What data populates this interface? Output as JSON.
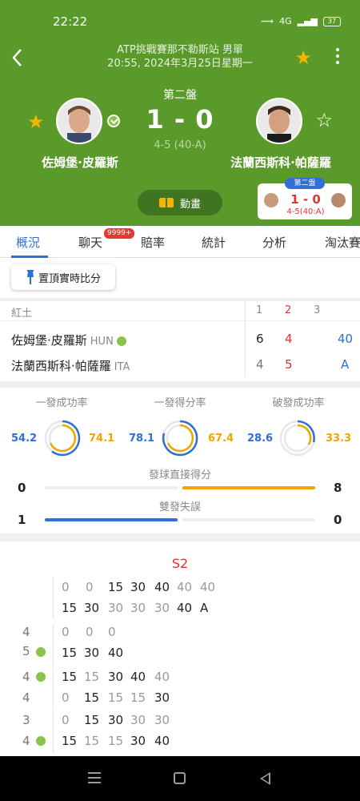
{
  "status_bar": {
    "time": "22:22",
    "icons": [
      "signal-icon",
      "network-icon",
      "wifi-icon"
    ],
    "network_label": "4G",
    "battery": "37"
  },
  "header": {
    "tournament": "ATP挑戰賽那不勒斯站 男單",
    "datetime": "20:55, 2024年3月25日星期一",
    "set_label": "第二盤",
    "score": "1 - 0",
    "subscore": "4-5 (40-A)",
    "favorite_star_color": "#f4b400",
    "header_color": "#5a9a2a"
  },
  "players": {
    "left": {
      "name": "佐姆堡·皮羅斯",
      "favorited": true,
      "serving": true
    },
    "right": {
      "name": "法蘭西斯科·帕薩羅",
      "favorited": false,
      "serving": false
    }
  },
  "animation_button": {
    "label": "動畫"
  },
  "mini_score": {
    "tag": "第二盤",
    "score": "1 - 0",
    "sub": "4-5(40:A)"
  },
  "tabs": [
    "概況",
    "聊天",
    "賠率",
    "統計",
    "分析",
    "淘汰賽"
  ],
  "active_tab": "概況",
  "chat_badge": "9999+",
  "pin_button": {
    "label": "置頂實時比分"
  },
  "score_table": {
    "surface": "紅土",
    "sets": [
      "1",
      "2",
      "3"
    ],
    "rows": [
      {
        "name": "佐姆堡·皮羅斯",
        "nat": "HUN",
        "s1": "6",
        "s2": "4",
        "pts": "40"
      },
      {
        "name": "法蘭西斯科·帕薩羅",
        "nat": "ITA",
        "s1": "4",
        "s2": "5",
        "pts": "A"
      }
    ]
  },
  "stats": {
    "rings": [
      {
        "title": "一發成功率",
        "left": "54.2",
        "right": "74.1"
      },
      {
        "title": "一發得分率",
        "left": "78.1",
        "right": "67.4"
      },
      {
        "title": "破發成功率",
        "left": "28.6",
        "right": "33.3"
      }
    ],
    "bars": [
      {
        "title": "發球直接得分",
        "left": "0",
        "right": "8"
      },
      {
        "title": "雙發失誤",
        "left": "1",
        "right": "0"
      }
    ],
    "colors": {
      "left": "#2f6fd6",
      "right": "#f0a500"
    }
  },
  "set_detail": {
    "tag": "S2",
    "current": {
      "top": [
        "0",
        "0",
        "15",
        "30",
        "40",
        "40",
        "40"
      ],
      "bottom": [
        "15",
        "30",
        "30",
        "30",
        "30",
        "40",
        "A"
      ]
    },
    "games": [
      {
        "top_games": "4",
        "bottom_games": "5",
        "server": "bottom",
        "points": [
          "15",
          "30",
          "40"
        ],
        "top_points": [
          "0",
          "0",
          "0"
        ]
      },
      {
        "top_games": "4",
        "bottom_games": "4",
        "server": "top",
        "top_points": [
          "15",
          "15",
          "30",
          "40",
          "40"
        ],
        "bottom_points": [
          "0",
          "15",
          "15",
          "15",
          "30"
        ]
      },
      {
        "top_games": "3",
        "bottom_games": "4",
        "server": "bottom",
        "top_points": [
          "0",
          "15",
          "30",
          "30",
          "30"
        ],
        "bottom_points": [
          "15",
          "15",
          "15",
          "30",
          "40"
        ]
      }
    ]
  }
}
